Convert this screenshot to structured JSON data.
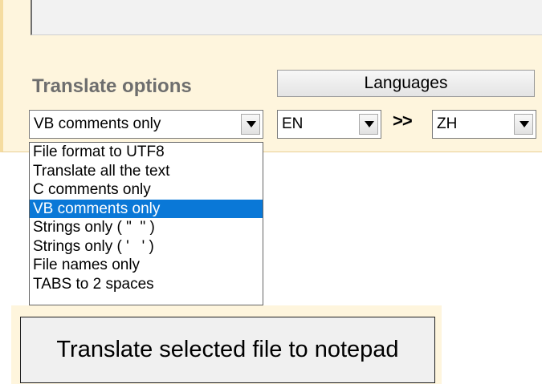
{
  "translate_options": {
    "title": "Translate options",
    "mode_select": {
      "selected": "VB comments only",
      "options": [
        "File format to UTF8",
        "Translate all the text",
        "C comments only",
        "VB comments only",
        "Strings only ( \"  \" )",
        "Strings only ( '   ' )",
        "File names only",
        "TABS to 2 spaces"
      ],
      "highlighted_index": 3
    }
  },
  "languages": {
    "button_label": "Languages",
    "source": "EN",
    "separator": ">>",
    "target": "ZH"
  },
  "actions": {
    "translate_button": "Translate selected file to notepad"
  },
  "colors": {
    "panel_bg": "#fef5dd",
    "selection": "#0a78d7"
  }
}
